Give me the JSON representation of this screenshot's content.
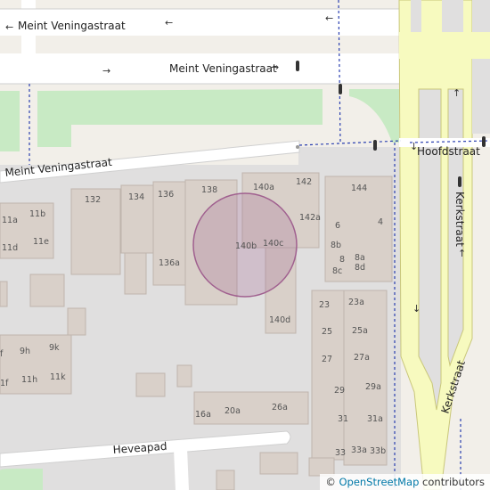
{
  "map": {
    "streets": {
      "meint_top": "Meint Veningastraat",
      "meint_middle": "Meint Veningastraat",
      "meint_lower": "Meint Veningastraat",
      "hoofdstraat": "Hoofdstraat",
      "kerkstraat_upper": "Kerkstraat",
      "kerkstraat_lower": "Kerkstraat",
      "heveapad": "Heveapad"
    },
    "house_numbers": {
      "n132": "132",
      "n134": "134",
      "n136": "136",
      "n138": "138",
      "n140a": "140a",
      "n142": "142",
      "n142a": "142a",
      "n144": "144",
      "n140b": "140b",
      "n140c": "140c",
      "n136a": "136a",
      "n140d": "140d",
      "n6": "6",
      "n4": "4",
      "n8b": "8b",
      "n8": "8",
      "n8a": "8a",
      "n8c": "8c",
      "n8d": "8d",
      "n11a": "11a",
      "n11b": "11b",
      "n11d": "11d",
      "n11e": "11e",
      "n9h": "9h",
      "n9k": "9k",
      "n11h": "11h",
      "n11k": "11k",
      "nf": "f",
      "n1f": "1f",
      "n23": "23",
      "n23a": "23a",
      "n25": "25",
      "n25a": "25a",
      "n27": "27",
      "n27a": "27a",
      "n29": "29",
      "n29a": "29a",
      "n31": "31",
      "n31a": "31a",
      "n33": "33",
      "n33a": "33a",
      "n33b": "33b",
      "n16a": "16a",
      "n20a": "20a",
      "n26a": "26a"
    },
    "marker_color": "#a0608f",
    "road_color": "#ffffff",
    "primary_road_color": "#f7fabf",
    "grass_color": "#c8eac4",
    "building_color": "#d9d0c9"
  },
  "attribution": {
    "prefix": "© ",
    "link": "OpenStreetMap",
    "suffix": " contributors"
  }
}
